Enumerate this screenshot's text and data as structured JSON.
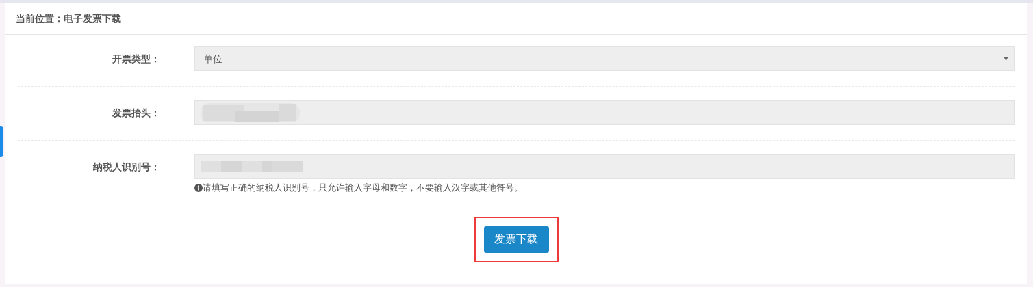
{
  "breadcrumb": "当前位置：电子发票下载",
  "fields": [
    {
      "label": "开票类型：",
      "kind": "select",
      "value": "单位"
    },
    {
      "label": "发票抬头：",
      "kind": "text",
      "redacted": true
    },
    {
      "label": "纳税人识别号：",
      "kind": "text",
      "redacted": true,
      "hint": "请填写正确的纳税人识别号，只允许输入字母和数字，不要输入汉字或其他符号。"
    }
  ],
  "button": {
    "label": "发票下载",
    "highlighted": true
  }
}
